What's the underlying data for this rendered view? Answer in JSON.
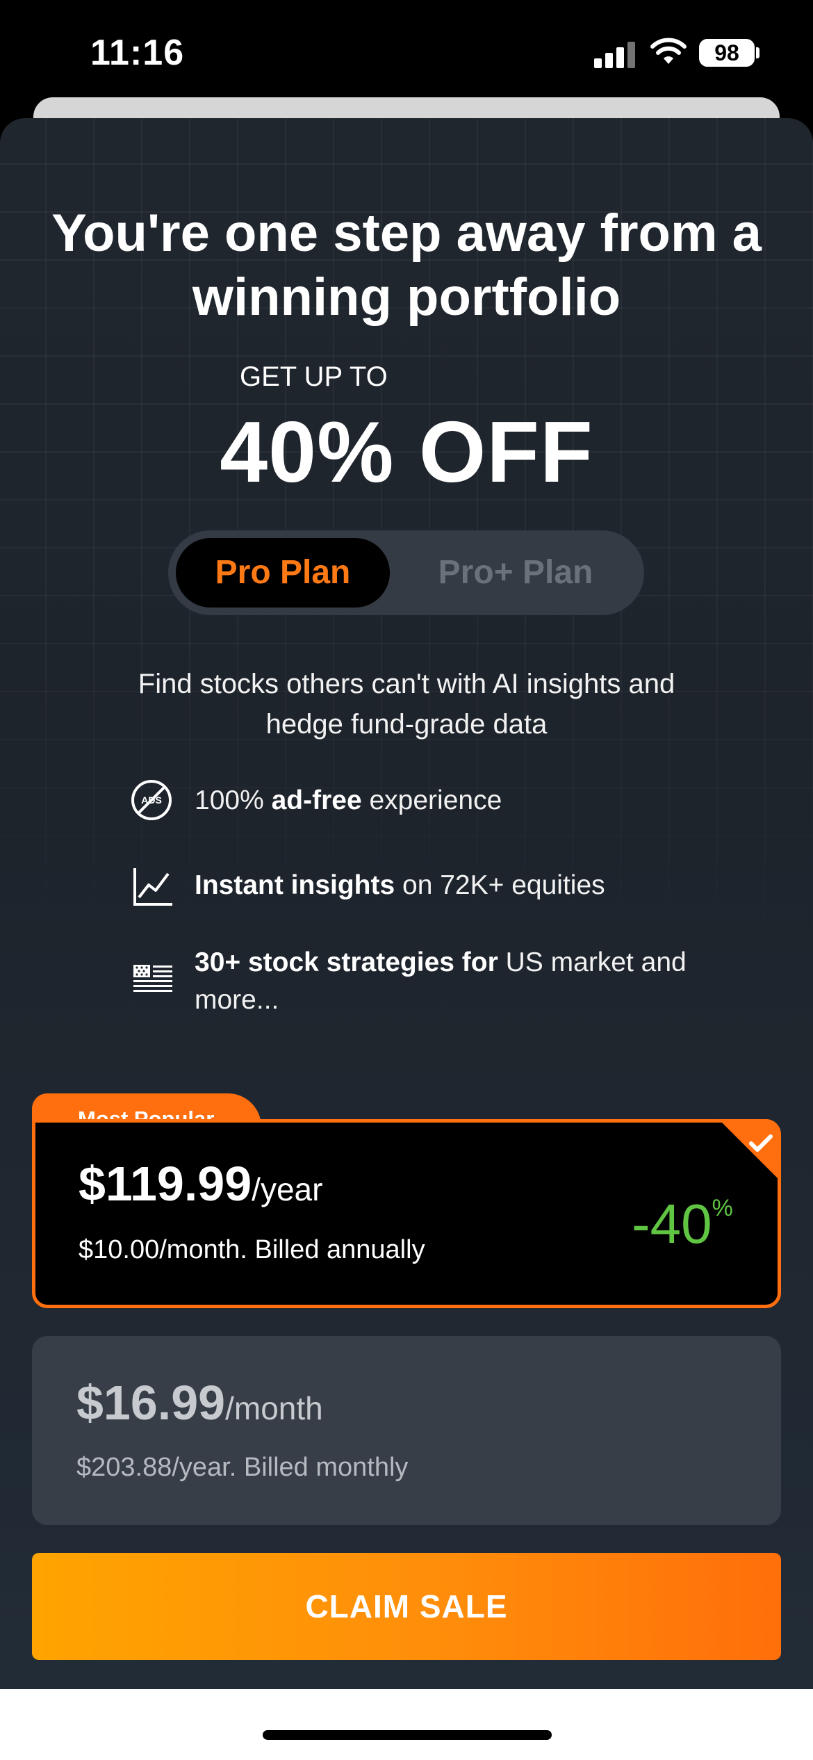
{
  "status_bar": {
    "time": "11:16",
    "battery": "98"
  },
  "header": {
    "title": "You're one step away from a winning portfolio",
    "promo_prefix": "GET UP TO",
    "promo_main": "40% OFF"
  },
  "plan_toggle": {
    "options": [
      "Pro Plan",
      "Pro+ Plan"
    ],
    "selected": "Pro Plan"
  },
  "description": "Find stocks others can't with AI insights and hedge fund-grade data",
  "features": [
    {
      "icon": "ads-blocked-icon",
      "pre": "100% ",
      "bold": "ad-free",
      "post": " experience"
    },
    {
      "icon": "line-chart-icon",
      "pre": "",
      "bold": "Instant insights",
      "post": " on 72K+ equities"
    },
    {
      "icon": "us-flag-icon",
      "pre": "",
      "bold": "30+ stock strategies for",
      "post": " US market and more..."
    }
  ],
  "plans": {
    "yearly": {
      "badge": "Most Popular",
      "price": "$119.99",
      "unit": "/year",
      "subtitle": "$10.00/month. Billed annually",
      "discount_value": "-40",
      "discount_unit": "%",
      "selected": true
    },
    "monthly": {
      "price": "$16.99",
      "unit": "/month",
      "subtitle": "$203.88/year. Billed monthly",
      "selected": false
    }
  },
  "cta_label": "CLAIM SALE",
  "colors": {
    "accent_orange": "#ff6f0f",
    "discount_green": "#5fc542",
    "background": "#20262d"
  }
}
